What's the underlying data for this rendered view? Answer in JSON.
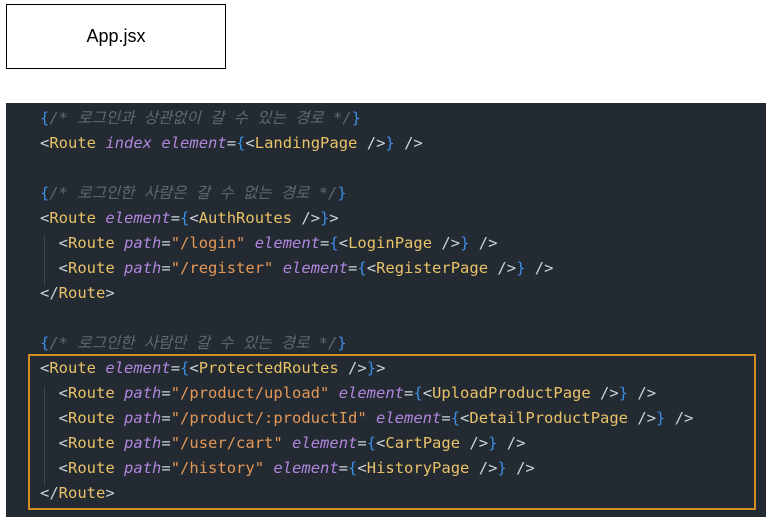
{
  "file_label": "App.jsx",
  "highlight_color": "#d28e1f",
  "colors": {
    "editor_background": "#242a31",
    "tag": "#e8c268",
    "attribute": "#b086de",
    "string": "#e39858",
    "brace": "#3b8ee8",
    "comment": "#5f6872"
  },
  "code": {
    "comment_public": "/* 로그인과 상관없이 갈 수 있는 경로 */",
    "comment_guest": "/* 로그인한 사람은 갈 수 없는 경로 */",
    "comment_auth": "/* 로그인한 사람만 갈 수 있는 경로 */",
    "route_tag": "Route",
    "attr_index": "index",
    "attr_element": "element",
    "attr_path": "path",
    "landing_page": "LandingPage",
    "auth_routes": "AuthRoutes",
    "login_path": "\"/login\"",
    "login_page": "LoginPage",
    "register_path": "\"/register\"",
    "register_page": "RegisterPage",
    "protected_routes": "ProtectedRoutes",
    "upload_path": "\"/product/upload\"",
    "upload_page": "UploadProductPage",
    "detail_path": "\"/product/:productId\"",
    "detail_page": "DetailProductPage",
    "cart_path": "\"/user/cart\"",
    "cart_page": "CartPage",
    "history_path": "\"/history\"",
    "history_page": "HistoryPage"
  }
}
